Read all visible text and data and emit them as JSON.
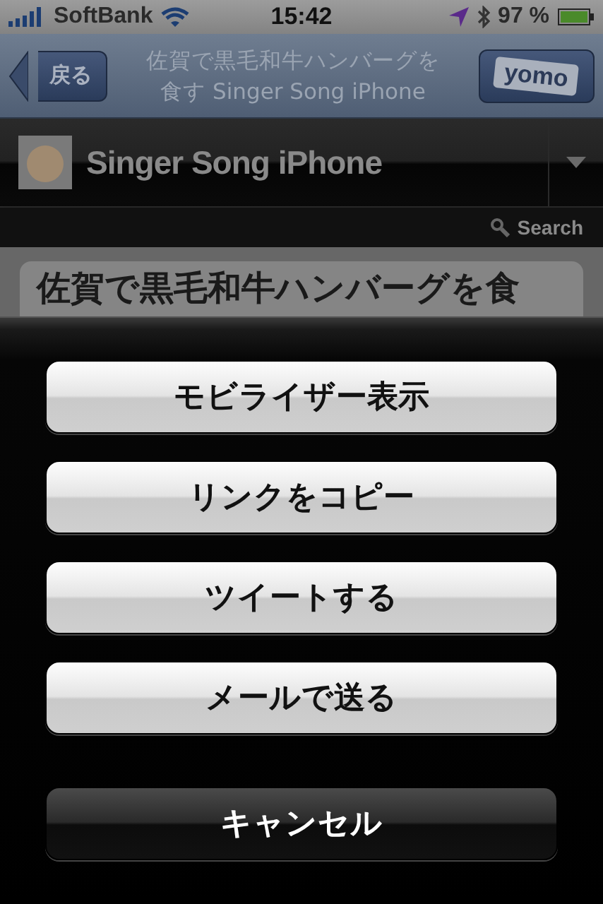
{
  "status_bar": {
    "carrier": "SoftBank",
    "time": "15:42",
    "battery": "97 %"
  },
  "nav_bar": {
    "back": "戻る",
    "title": "佐賀で黒毛和牛ハンバーグを食す Singer Song iPhone",
    "right_button": "yomo"
  },
  "blog_header": {
    "title": "Singer Song iPhone",
    "search": "Search"
  },
  "article": {
    "title": "佐賀で黒毛和牛ハンバーグを食"
  },
  "action_sheet": {
    "buttons": [
      {
        "label": "モビライザー表示",
        "kind": "action"
      },
      {
        "label": "リンクをコピー",
        "kind": "action"
      },
      {
        "label": "ツイートする",
        "kind": "action"
      },
      {
        "label": "メールで送る",
        "kind": "action"
      },
      {
        "label": "キャンセル",
        "kind": "cancel"
      }
    ]
  }
}
